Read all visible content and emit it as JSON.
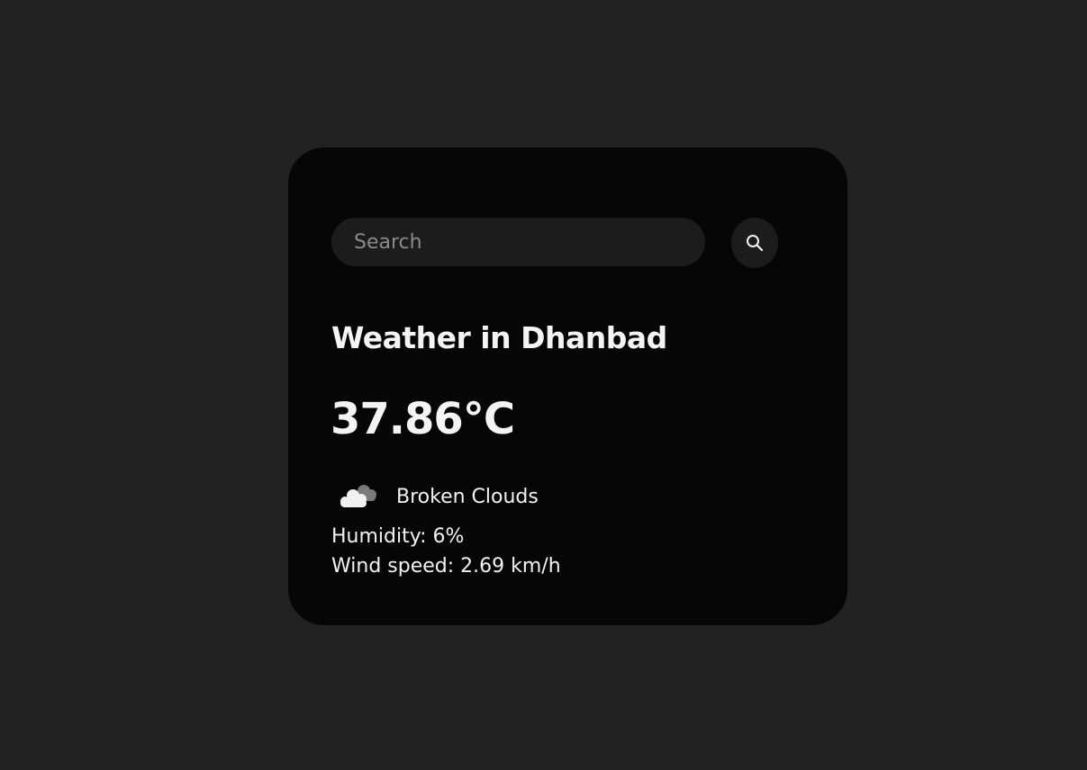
{
  "search": {
    "placeholder": "Search",
    "value": "",
    "button_icon": "search-icon"
  },
  "weather": {
    "title": "Weather in Dhanbad",
    "temperature": "37.86°C",
    "condition_icon": "broken-clouds-icon",
    "description": "Broken Clouds",
    "humidity": "Humidity: 6%",
    "wind_speed": "Wind speed: 2.69 km/h"
  },
  "colors": {
    "page_background": "#222222",
    "card_background": "#060606",
    "input_background": "#1c1c1c",
    "text": "#f4f4f4",
    "placeholder": "#8a8a8a"
  }
}
